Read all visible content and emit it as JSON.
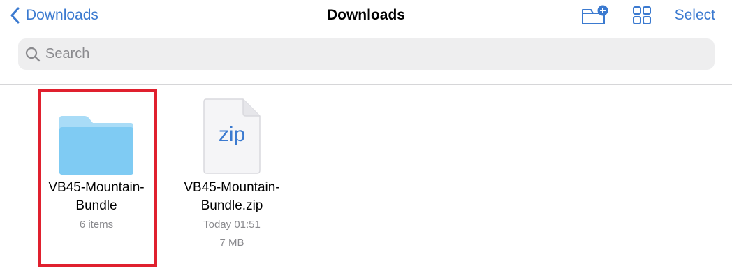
{
  "nav": {
    "back_label": "Downloads",
    "back_icon": "chevron-left-icon",
    "title": "Downloads",
    "new_folder_icon": "folder-badge-plus-icon",
    "view_toggle_icon": "grid-icon",
    "select_label": "Select"
  },
  "search": {
    "placeholder": "Search",
    "value": "",
    "icon": "magnifying-glass-icon"
  },
  "items": [
    {
      "kind": "folder",
      "icon": "folder-icon",
      "name_line1": "VB45-Mountain-",
      "name_line2": "Bundle",
      "meta1": "6 items",
      "highlighted": true
    },
    {
      "kind": "zip",
      "icon": "zip-file-icon",
      "icon_label": "zip",
      "name_line1": "VB45-Mountain-",
      "name_line2": "Bundle.zip",
      "meta1": "Today 01:51",
      "meta2": "7 MB",
      "highlighted": false
    }
  ],
  "colors": {
    "accent": "#3b7ad0",
    "highlight": "#e0202e",
    "folder_light": "#a9dcf7",
    "folder_dark": "#7fcbf3",
    "secondary_text": "#8a8a8e"
  }
}
